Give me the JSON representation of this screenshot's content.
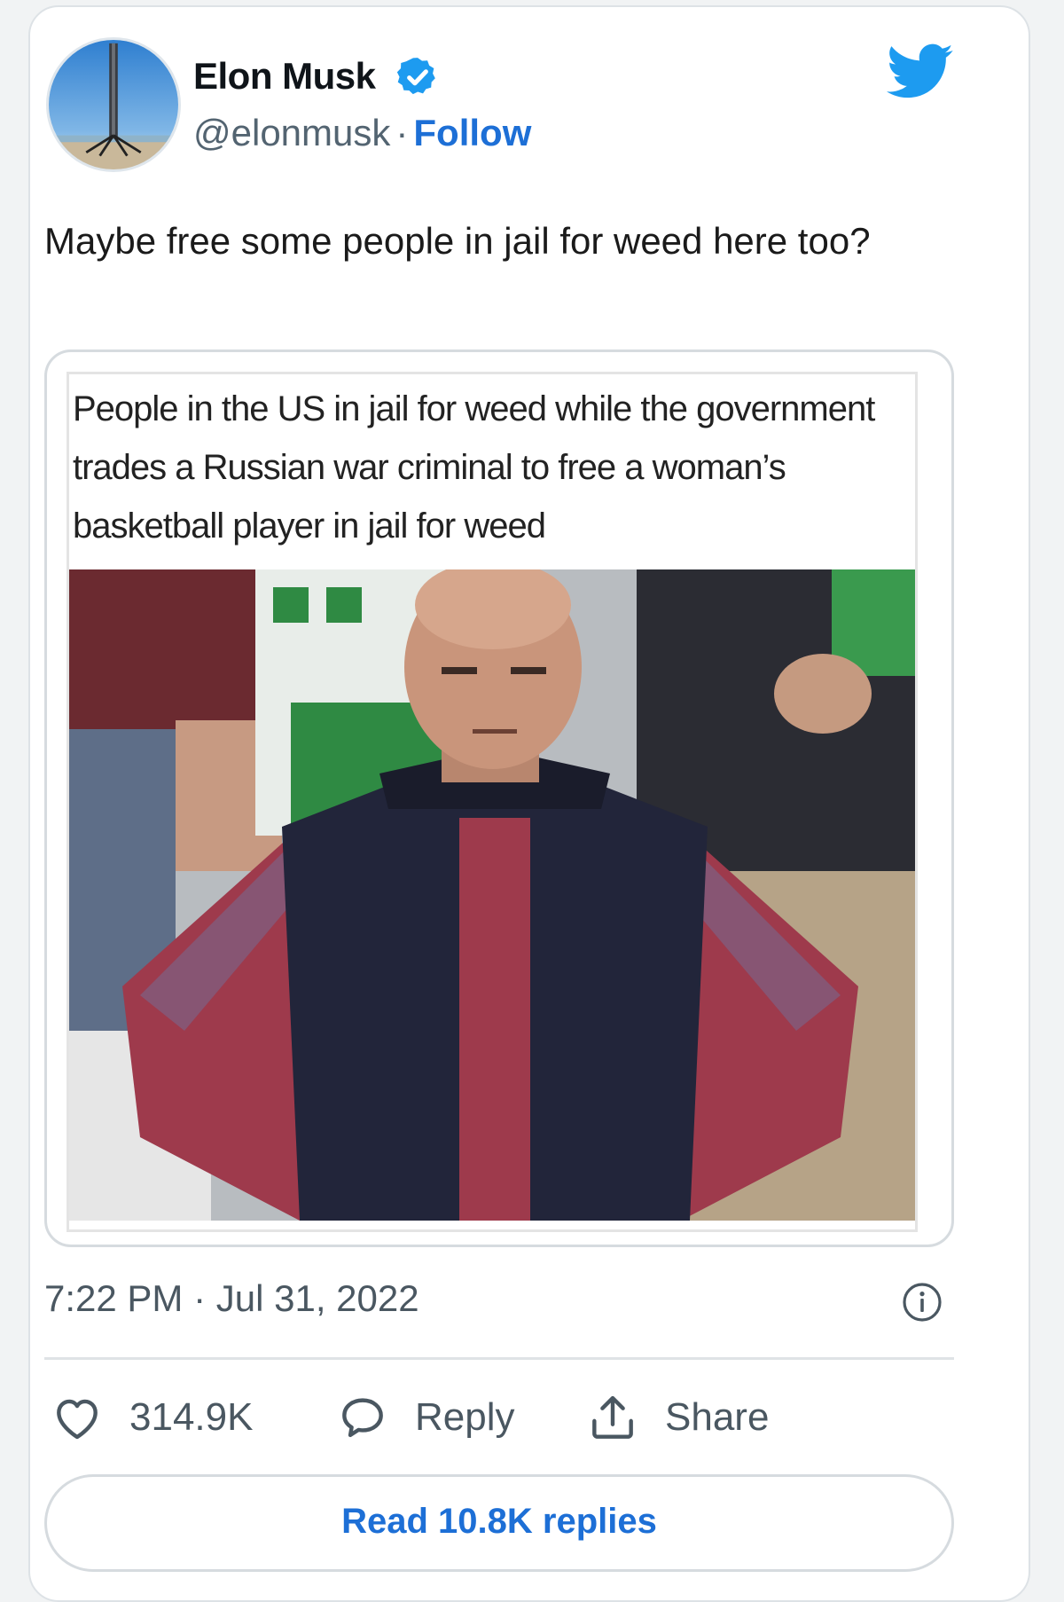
{
  "author": {
    "name": "Elon Musk",
    "handle": "@elonmusk",
    "separator": "·",
    "follow_label": "Follow"
  },
  "tweet": {
    "text": "Maybe free some people in jail for weed here too?"
  },
  "quote": {
    "caption": "People in the US in jail for weed while the government trades a Russian war criminal to free a woman’s basketball player in jail for weed"
  },
  "meta": {
    "timestamp": "7:22 PM · Jul 31, 2022"
  },
  "actions": {
    "likes_count": "314.9K",
    "reply_label": "Reply",
    "share_label": "Share",
    "read_replies_label": "Read 10.8K replies"
  },
  "icons": {
    "verified": "verified-badge-icon",
    "brand": "twitter-bird-icon",
    "info": "info-icon",
    "like": "heart-icon",
    "reply": "speech-bubble-icon",
    "share": "share-upload-icon"
  },
  "colors": {
    "accent": "#1d6fd6",
    "twitter_blue": "#1d9bf0",
    "muted_text": "#4a5761"
  }
}
